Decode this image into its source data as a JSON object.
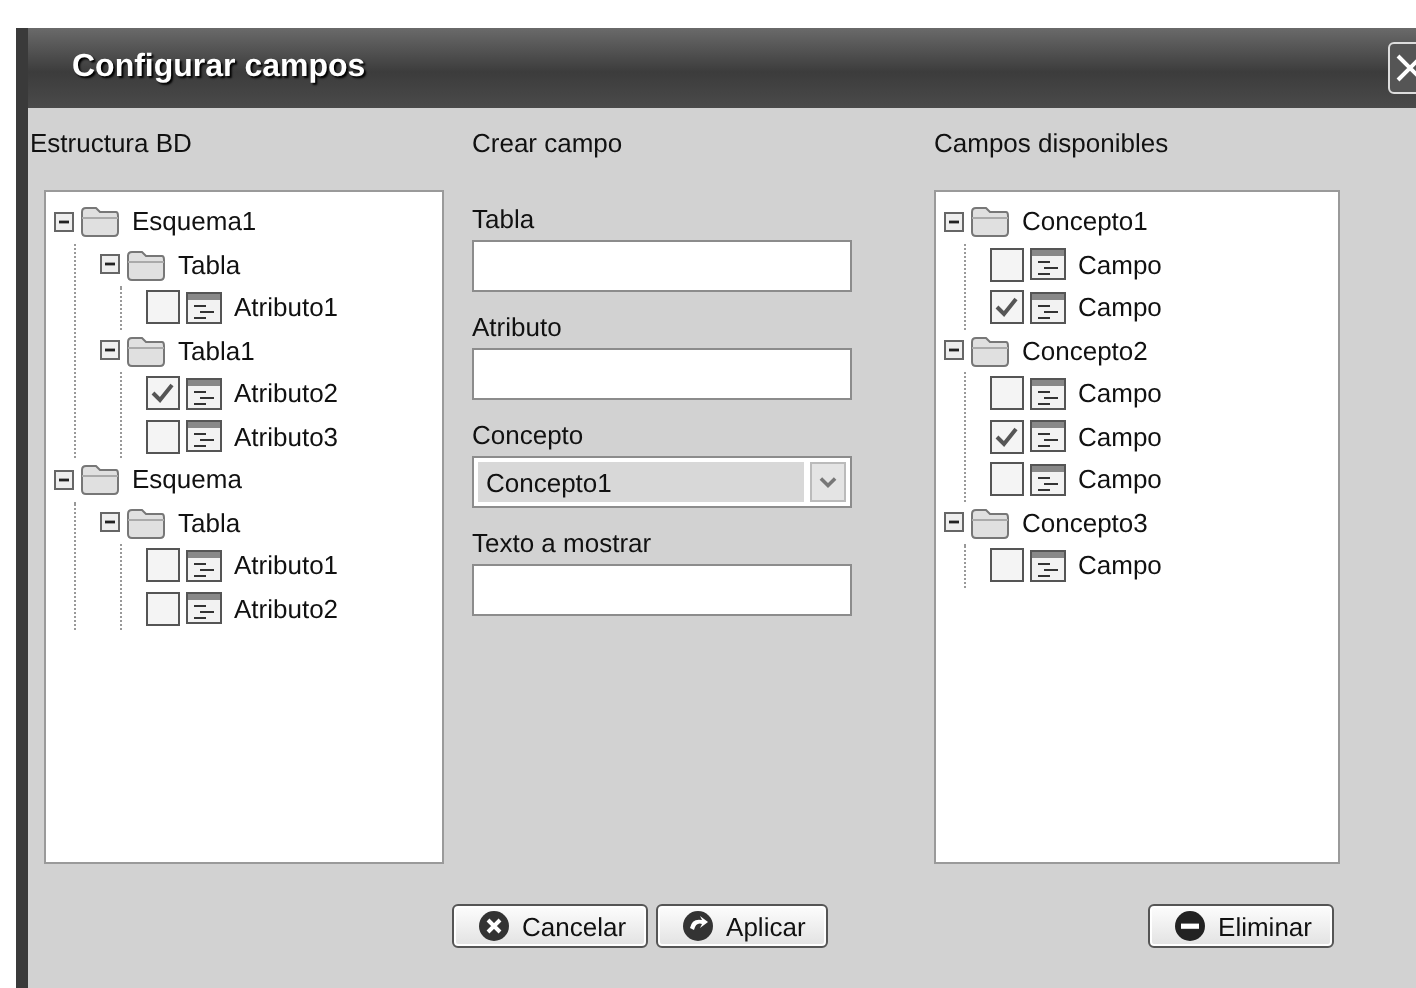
{
  "window": {
    "title": "Configurar campos"
  },
  "structure": {
    "heading": "Estructura BD",
    "tree": [
      {
        "kind": "folder",
        "label": "Esquema1",
        "expanded": true,
        "children": [
          {
            "kind": "folder",
            "label": "Tabla",
            "expanded": true,
            "children": [
              {
                "kind": "field",
                "label": "Atributo1",
                "checked": false
              }
            ]
          },
          {
            "kind": "folder",
            "label": "Tabla1",
            "expanded": true,
            "children": [
              {
                "kind": "field",
                "label": "Atributo2",
                "checked": true
              },
              {
                "kind": "field",
                "label": "Atributo3",
                "checked": false
              }
            ]
          }
        ]
      },
      {
        "kind": "folder",
        "label": "Esquema",
        "expanded": true,
        "children": [
          {
            "kind": "folder",
            "label": "Tabla",
            "expanded": true,
            "children": [
              {
                "kind": "field",
                "label": "Atributo1",
                "checked": false
              },
              {
                "kind": "field",
                "label": "Atributo2",
                "checked": false
              }
            ]
          }
        ]
      }
    ]
  },
  "create": {
    "heading": "Crear campo",
    "fields": [
      {
        "kind": "text",
        "label": "Tabla"
      },
      {
        "kind": "text",
        "label": "Atributo"
      },
      {
        "kind": "select",
        "label": "Concepto",
        "value": "Concepto1"
      },
      {
        "kind": "text",
        "label": "Texto a mostrar"
      }
    ],
    "buttons": [
      {
        "kind": "cancel",
        "label": "Cancelar"
      },
      {
        "kind": "apply",
        "label": "Aplicar"
      }
    ]
  },
  "available": {
    "heading": "Campos disponibles",
    "tree": [
      {
        "kind": "folder",
        "label": "Concepto1",
        "expanded": true,
        "children": [
          {
            "kind": "field",
            "label": "Campo",
            "checked": false
          },
          {
            "kind": "field",
            "label": "Campo",
            "checked": true
          }
        ]
      },
      {
        "kind": "folder",
        "label": "Concepto2",
        "expanded": true,
        "children": [
          {
            "kind": "field",
            "label": "Campo",
            "checked": false
          },
          {
            "kind": "field",
            "label": "Campo",
            "checked": true
          },
          {
            "kind": "field",
            "label": "Campo",
            "checked": false
          }
        ]
      },
      {
        "kind": "folder",
        "label": "Concepto3",
        "expanded": true,
        "children": [
          {
            "kind": "field",
            "label": "Campo",
            "checked": false
          }
        ]
      }
    ],
    "buttons": [
      {
        "kind": "delete",
        "label": "Eliminar"
      }
    ]
  }
}
